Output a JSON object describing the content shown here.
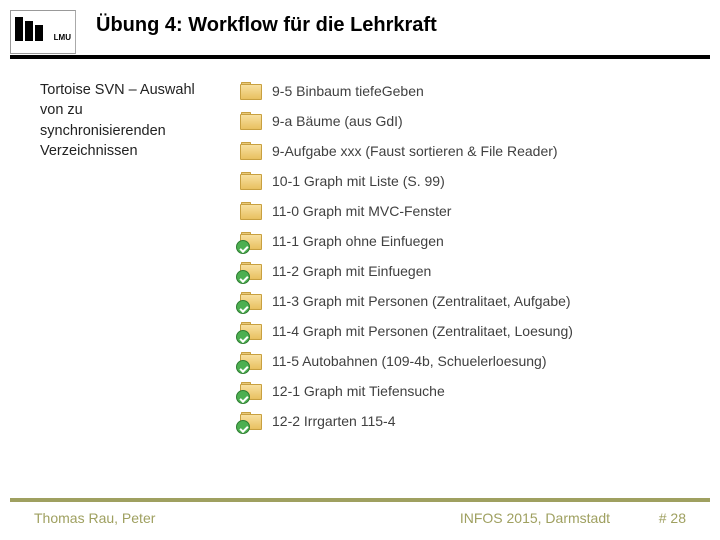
{
  "header": {
    "title": "Übung 4: Workflow für die Lehrkraft"
  },
  "note": {
    "text": "Tortoise SVN – Auswahl von zu synchronisierenden Verzeichnissen"
  },
  "folders": [
    {
      "name": "9-5 Binbaum tiefeGeben",
      "overlay": "none"
    },
    {
      "name": "9-a Bäume (aus GdI)",
      "overlay": "none"
    },
    {
      "name": "9-Aufgabe xxx (Faust sortieren & File Reader)",
      "overlay": "none"
    },
    {
      "name": "10-1 Graph mit Liste (S. 99)",
      "overlay": "none"
    },
    {
      "name": "11-0 Graph mit MVC-Fenster",
      "overlay": "none"
    },
    {
      "name": "11-1 Graph ohne Einfuegen",
      "overlay": "green"
    },
    {
      "name": "11-2 Graph mit Einfuegen",
      "overlay": "green"
    },
    {
      "name": "11-3 Graph mit Personen (Zentralitaet, Aufgabe)",
      "overlay": "green"
    },
    {
      "name": "11-4 Graph mit Personen (Zentralitaet, Loesung)",
      "overlay": "green"
    },
    {
      "name": "11-5  Autobahnen (109-4b, Schuelerloesung)",
      "overlay": "green"
    },
    {
      "name": "12-1 Graph mit Tiefensuche",
      "overlay": "green"
    },
    {
      "name": "12-2 Irrgarten 115-4",
      "overlay": "green"
    }
  ],
  "footer": {
    "author": "Thomas Rau, Peter",
    "conference": "INFOS 2015, Darmstadt",
    "page": "# 28"
  }
}
